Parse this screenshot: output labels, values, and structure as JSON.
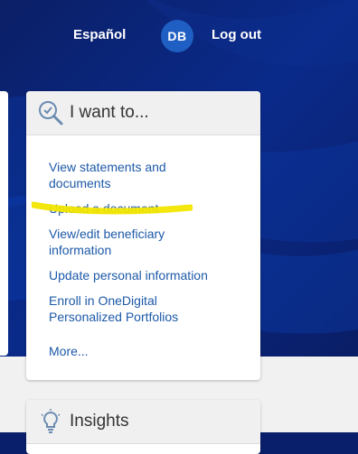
{
  "header": {
    "language_link": "Español",
    "avatar_initials": "DB",
    "logout_label": "Log out"
  },
  "want_card": {
    "title": "I want to...",
    "icon": "magnifier-check-icon",
    "links": [
      "View statements and documents",
      "Upload a document",
      "View/edit beneficiary information",
      "Update personal information",
      "Enroll in OneDigital Personalized Portfolios"
    ],
    "more_label": "More..."
  },
  "insights_card": {
    "title": "Insights",
    "icon": "lightbulb-icon"
  },
  "colors": {
    "brand_dark": "#0a1f6b",
    "avatar": "#1f5fc3",
    "link": "#1d59a8",
    "highlight": "#f2e600"
  }
}
